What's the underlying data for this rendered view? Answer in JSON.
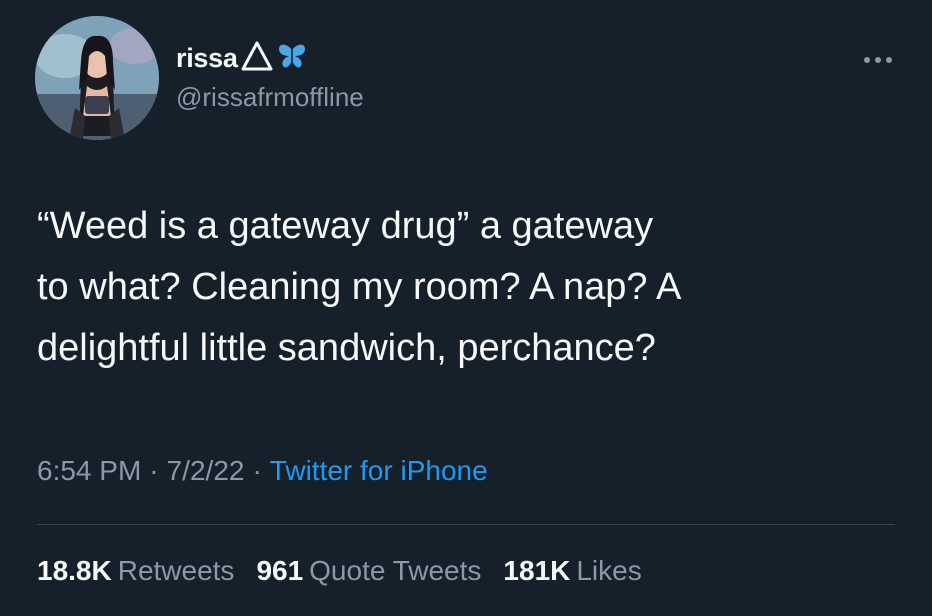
{
  "tweet": {
    "author": {
      "display_name": "rissa",
      "name_emojis": [
        "triangle-icon",
        "butterfly-icon"
      ],
      "handle": "@rissafrmoffline",
      "avatar": "profile-photo"
    },
    "text": "“Weed is a gateway drug” a gateway\nto what? Cleaning my room? A nap? A\ndelightful little sandwich, perchance?",
    "time": "6:54 PM",
    "date": "7/2/22",
    "separator": "·",
    "source": "Twitter for iPhone",
    "stats": {
      "retweets_count": "18.8K",
      "retweets_label": "Retweets",
      "quotes_count": "961",
      "quotes_label": "Quote Tweets",
      "likes_count": "181K",
      "likes_label": "Likes"
    }
  },
  "colors": {
    "background": "#15202b",
    "text": "#f7f9f9",
    "secondary": "#8b98a5",
    "link": "#1d9bf0",
    "divider": "#38444d",
    "butterfly": "#4aa8e8"
  }
}
